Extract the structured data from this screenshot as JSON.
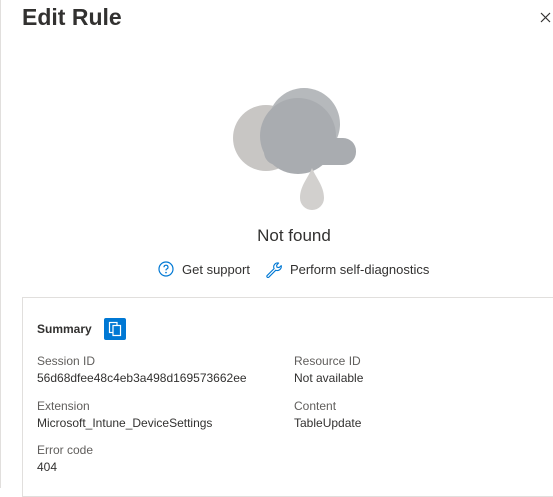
{
  "header": {
    "title": "Edit Rule"
  },
  "error": {
    "status": "Not found"
  },
  "actions": {
    "get_support": "Get support",
    "self_diagnostics": "Perform self-diagnostics"
  },
  "summary": {
    "heading": "Summary",
    "fields": {
      "session_id": {
        "label": "Session ID",
        "value": "56d68dfee48c4eb3a498d169573662ee"
      },
      "resource_id": {
        "label": "Resource ID",
        "value": "Not available"
      },
      "extension": {
        "label": "Extension",
        "value": "Microsoft_Intune_DeviceSettings"
      },
      "content": {
        "label": "Content",
        "value": "TableUpdate"
      },
      "error_code": {
        "label": "Error code",
        "value": "404"
      }
    }
  },
  "icons": {
    "close": "close-icon",
    "illustration": "rain-cloud-icon",
    "help": "question-circle-icon",
    "diagnostics": "wrench-icon",
    "copy": "copy-icon"
  },
  "colors": {
    "accent": "#0078d4",
    "text": "#323130",
    "muted": "#605e5c"
  }
}
